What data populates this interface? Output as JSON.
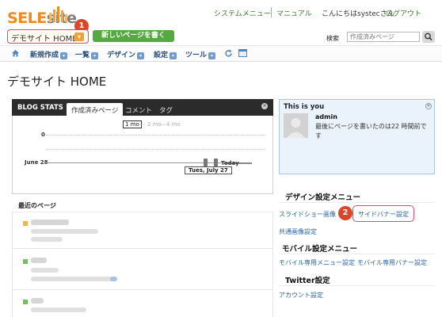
{
  "logo": {
    "part1": "SELE",
    "part2": "site"
  },
  "topnav": {
    "system_menu": "システムメニュー",
    "manual": "マニュアル",
    "greeting": "こんにちはsystecさん",
    "logout": "ログアウト"
  },
  "site_selector": {
    "label": "デモサイト HOME",
    "arrow": "▾"
  },
  "new_page_button": "新しいページを書く",
  "search": {
    "label": "検索",
    "placeholder": "作成済みページ"
  },
  "menu": [
    {
      "label": "新規作成"
    },
    {
      "label": "一覧"
    },
    {
      "label": "デザイン"
    },
    {
      "label": "設定"
    },
    {
      "label": "ツール"
    }
  ],
  "page_title": "デモサイト HOME",
  "blog_stats": {
    "title": "BLOG STATS",
    "tabs": [
      "作成済みページ",
      "コメント",
      "タグ"
    ],
    "close": "×",
    "ranges": {
      "r1": "1 mo",
      "r2": "2 mo",
      "r3": "4 mo"
    },
    "y_zero": "0",
    "start_date": "June 28",
    "end_label": "Today",
    "selected_date": "Tues, July 27"
  },
  "recent_pages_title": "最近のページ",
  "you_box": {
    "title": "This is you",
    "close": "×",
    "name": "admin",
    "text": "最後にページを書いたのは22 時間前です"
  },
  "design_menu": {
    "title": "デザイン設定メニュー",
    "slideshow": "スライドショー画像",
    "sidebanner": "サイドバナー設定",
    "common_image": "共通画像設定"
  },
  "mobile_menu": {
    "title": "モバイル設定メニュー",
    "menu_setting": "モバイル専用メニュー設定",
    "banner_setting": "モバイル専用バナー設定"
  },
  "twitter": {
    "title": "Twitter設定",
    "account": "アカウント設定"
  },
  "badges": {
    "b1": "1",
    "b2": "2"
  },
  "colors": {
    "accent_orange": "#f08a1c",
    "accent_green": "#56a840",
    "highlight_pink": "#d64a7d",
    "badge_red": "#d9462a"
  }
}
